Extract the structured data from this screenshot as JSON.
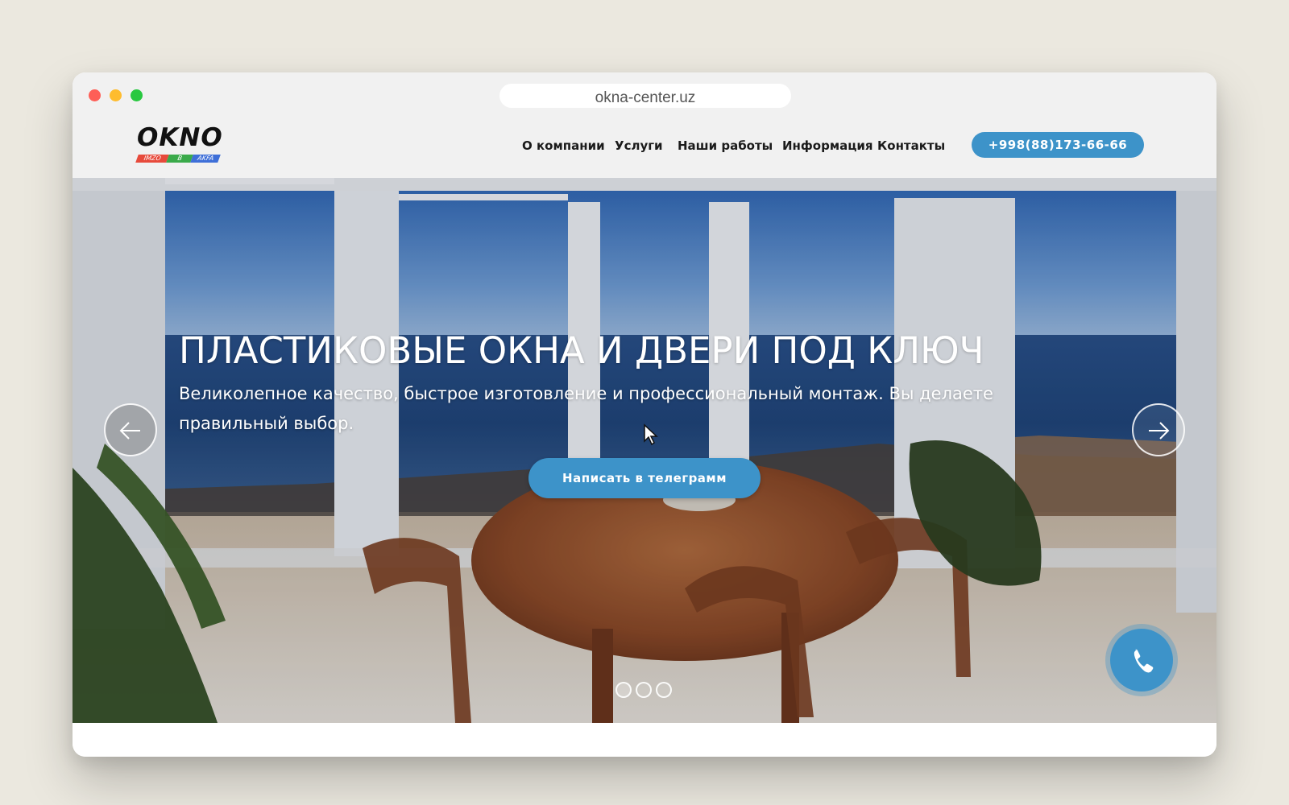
{
  "browser": {
    "url": "okna-center.uz"
  },
  "logo": {
    "word": "OKNO",
    "seg1": "IMZO",
    "seg2": "B",
    "seg3": "AKFA"
  },
  "nav": {
    "items": [
      {
        "label": "О компании"
      },
      {
        "label": "Услуги"
      },
      {
        "label": "Наши работы"
      },
      {
        "label": "Информация"
      },
      {
        "label": "Контакты"
      }
    ],
    "phone": "+998(88)173-66-66"
  },
  "hero": {
    "title": "ПЛАСТИКОВЫЕ ОКНА И ДВЕРИ ПОД КЛЮЧ",
    "subtitle": "Великолепное качество, быстрое изготовление и профессиональный монтаж. Вы делаете правильный выбор.",
    "cta": "Написать в телеграмм",
    "slides_total": 3,
    "active_slide": 1
  },
  "colors": {
    "accent": "#3d93c9",
    "page_bg": "#ebe8df",
    "header_bg": "#f1f1f1"
  },
  "icons": {
    "prev": "arrow-left-icon",
    "next": "arrow-right-icon",
    "call": "phone-icon",
    "cursor": "mouse-cursor-icon"
  }
}
